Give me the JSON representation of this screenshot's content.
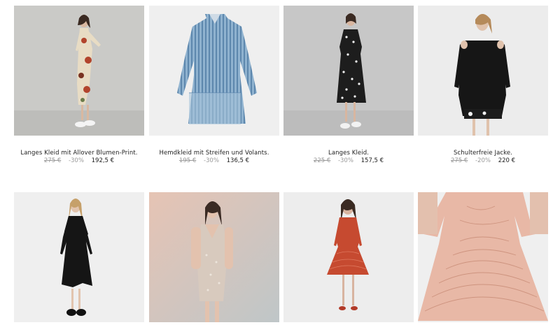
{
  "products": [
    {
      "title": "Langes Kleid mit Allover Blumen-Print.",
      "old_price": "275 €",
      "discount": "-30%",
      "price": "192,5 €",
      "image_icon": "floral-long-dress-photo",
      "bg": "#c9c8c5"
    },
    {
      "title": "Hemdkleid mit Streifen und Volants.",
      "old_price": "195 €",
      "discount": "-30%",
      "price": "136,5 €",
      "image_icon": "striped-shirt-dress-photo",
      "bg": "#eeeeee"
    },
    {
      "title": "Langes Kleid.",
      "old_price": "225 €",
      "discount": "-30%",
      "price": "157,5 €",
      "image_icon": "dotted-long-dress-photo",
      "bg": "#c6c6c6"
    },
    {
      "title": "Schulterfreie Jacke.",
      "old_price": "275 €",
      "discount": "-20%",
      "price": "220 €",
      "image_icon": "cold-shoulder-jacket-photo",
      "bg": "#eaeaea"
    },
    {
      "title": "",
      "old_price": "",
      "discount": "",
      "price": "",
      "image_icon": "black-pleated-dress-photo",
      "bg": "#efefef"
    },
    {
      "title": "",
      "old_price": "",
      "discount": "",
      "price": "",
      "image_icon": "sequin-mini-dress-photo",
      "bg": "#d9c8c0"
    },
    {
      "title": "",
      "old_price": "",
      "discount": "",
      "price": "",
      "image_icon": "red-lace-dress-photo",
      "bg": "#ececec"
    },
    {
      "title": "",
      "old_price": "",
      "discount": "",
      "price": "",
      "image_icon": "pink-lace-dress-photo",
      "bg": "#eeeeee"
    }
  ]
}
